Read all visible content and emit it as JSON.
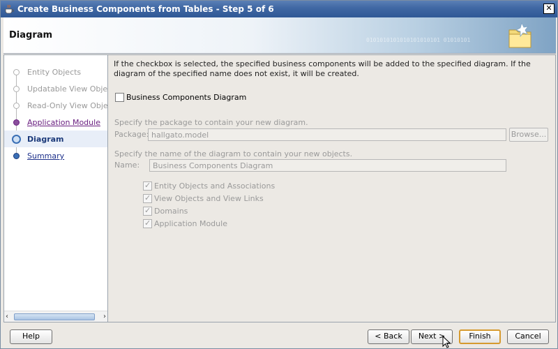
{
  "window": {
    "title": "Create Business Components from Tables - Step 5 of 6",
    "close_glyph": "✕"
  },
  "header": {
    "title": "Diagram",
    "binary_decoration": "0101010101010101010101 01010101"
  },
  "steps": [
    {
      "label": "Entity Objects",
      "state": "disabled"
    },
    {
      "label": "Updatable View Objects",
      "state": "disabled"
    },
    {
      "label": "Read-Only View Objects",
      "state": "disabled"
    },
    {
      "label": "Application Module",
      "state": "visited"
    },
    {
      "label": "Diagram",
      "state": "current"
    },
    {
      "label": "Summary",
      "state": "link"
    }
  ],
  "content": {
    "description": "If the checkbox is selected, the specified business components will be added to the specified diagram.  If the diagram of the specified name does not exist, it will be created.",
    "main_checkbox": {
      "label": "Business Components Diagram",
      "checked": false
    },
    "package_hint": "Specify the package to contain your new diagram.",
    "package_label": "Package:",
    "package_value": "hallgato.model",
    "browse_label": "Browse...",
    "name_hint": "Specify the name of the diagram to contain your new objects.",
    "name_label": "Name:",
    "name_value": "Business Components Diagram",
    "options": [
      {
        "label": "Entity Objects and Associations",
        "checked": true
      },
      {
        "label": "View Objects and View Links",
        "checked": true
      },
      {
        "label": "Domains",
        "checked": true
      },
      {
        "label": "Application Module",
        "checked": true
      }
    ]
  },
  "footer": {
    "help": "Help",
    "back": "< Back",
    "next": "Next >",
    "finish": "Finish",
    "cancel": "Cancel"
  },
  "colors": {
    "title_bar": "#3f67a3",
    "current_step_text": "#1c3a7a",
    "visited_link": "#6a1f80",
    "link": "#1c2f8a",
    "default_button_border": "#d69a2f"
  }
}
